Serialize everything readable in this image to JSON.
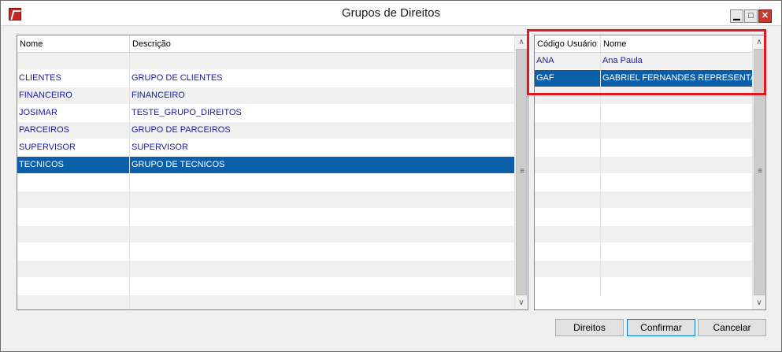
{
  "window": {
    "title": "Grupos de Direitos",
    "controls": {
      "minimize": "▁",
      "maximize": "□",
      "close": "✕"
    }
  },
  "groups_table": {
    "columns": [
      "Nome",
      "Descrição"
    ],
    "rows": [
      [
        "",
        ""
      ],
      [
        "CLIENTES",
        "GRUPO DE CLIENTES"
      ],
      [
        "FINANCEIRO",
        "FINANCEIRO"
      ],
      [
        "JOSIMAR",
        "TESTE_GRUPO_DIREITOS"
      ],
      [
        "PARCEIROS",
        "GRUPO DE PARCEIROS"
      ],
      [
        "SUPERVISOR",
        "SUPERVISOR"
      ],
      [
        "TECNICOS",
        "GRUPO DE TECNICOS"
      ],
      [
        "",
        ""
      ],
      [
        "",
        ""
      ],
      [
        "",
        ""
      ],
      [
        "",
        ""
      ],
      [
        "",
        ""
      ],
      [
        "",
        ""
      ],
      [
        "",
        ""
      ],
      [
        "",
        ""
      ]
    ],
    "selected_row": 6
  },
  "users_table": {
    "columns": [
      "Código Usuário",
      "Nome"
    ],
    "rows": [
      [
        "ANA",
        "Ana Paula"
      ],
      [
        "GAF",
        "GABRIEL FERNANDES REPRESENTAÇÕ"
      ],
      [
        "",
        ""
      ],
      [
        "",
        ""
      ],
      [
        "",
        ""
      ],
      [
        "",
        ""
      ],
      [
        "",
        ""
      ],
      [
        "",
        ""
      ],
      [
        "",
        ""
      ],
      [
        "",
        ""
      ],
      [
        "",
        ""
      ],
      [
        "",
        ""
      ],
      [
        "",
        ""
      ],
      [
        "",
        ""
      ]
    ],
    "selected_row": 1
  },
  "scrollbar": {
    "up": "∧",
    "down": "∨",
    "grip": "≡"
  },
  "buttons": {
    "direitos": "Direitos",
    "confirmar": "Confirmar",
    "cancelar": "Cancelar"
  },
  "colors": {
    "selection": "#0b5fa8",
    "row_text": "#1a1aa6",
    "highlight": "#e3191e"
  }
}
